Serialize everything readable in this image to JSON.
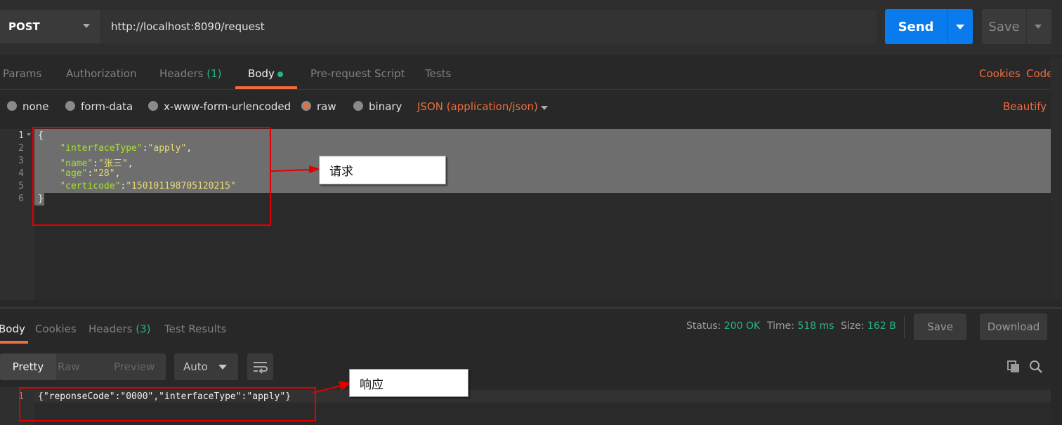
{
  "request": {
    "method": "POST",
    "url": "http://localhost:8090/request",
    "send_label": "Send",
    "save_label": "Save"
  },
  "request_tabs": {
    "params": "Params",
    "authorization": "Authorization",
    "headers": "Headers",
    "headers_count": "(1)",
    "body": "Body",
    "pre_request": "Pre-request Script",
    "tests": "Tests",
    "cookies": "Cookies",
    "code": "Code"
  },
  "body_types": {
    "none": "none",
    "form_data": "form-data",
    "urlencoded": "x-www-form-urlencoded",
    "raw": "raw",
    "binary": "binary",
    "selected": "raw",
    "content_type": "JSON (application/json)",
    "beautify": "Beautify"
  },
  "request_body": {
    "line_numbers": [
      "1",
      "2",
      "3",
      "4",
      "5",
      "6"
    ],
    "open_brace": "{",
    "close_brace": "}",
    "lines": [
      {
        "key": "\"interfaceType\"",
        "value": "\"apply\"",
        "trail": ","
      },
      {
        "key": "\"name\"",
        "value": "\"张三\"",
        "trail": ","
      },
      {
        "key": "\"age\"",
        "value": "\"28\"",
        "trail": ","
      },
      {
        "key": "\"certicode\"",
        "value": "\"150101198705120215\"",
        "trail": ""
      }
    ]
  },
  "response_tabs": {
    "body": "Body",
    "cookies": "Cookies",
    "headers": "Headers",
    "headers_count": "(3)",
    "test_results": "Test Results"
  },
  "response_meta": {
    "status_label": "Status:",
    "status_value": "200 OK",
    "time_label": "Time:",
    "time_value": "518 ms",
    "size_label": "Size:",
    "size_value": "162 B",
    "save_label": "Save",
    "download_label": "Download"
  },
  "response_view": {
    "pretty": "Pretty",
    "raw": "Raw",
    "preview": "Preview",
    "format": "Auto"
  },
  "response_body": {
    "line_number": "1",
    "content": "{\"reponseCode\":\"0000\",\"interfaceType\":\"apply\"}"
  },
  "annotations": {
    "request_note": "请求",
    "response_note": "响应",
    "highlight_color": "#e00000"
  },
  "colors": {
    "accent": "#f26b3a",
    "send": "#097bed",
    "success": "#26b47f"
  }
}
